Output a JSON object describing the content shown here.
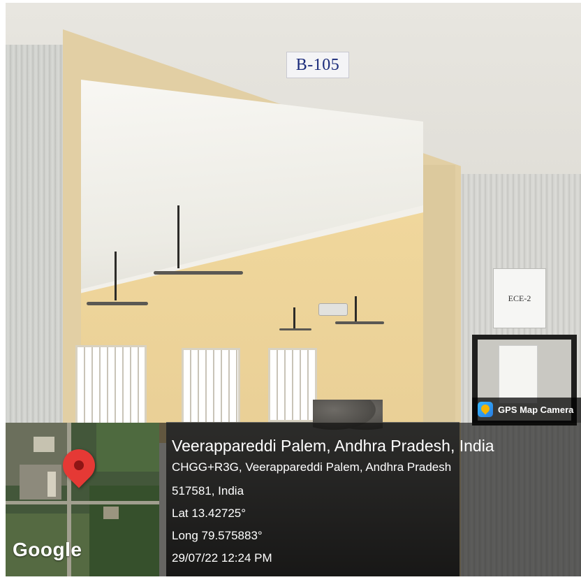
{
  "scene": {
    "room_sign": "B-105",
    "door_sign": "ECE-2"
  },
  "overlay": {
    "badge_label": "GPS Map Camera",
    "badge_icon": "gps-map-camera-icon",
    "map_watermark": "Google",
    "title": "Veerappareddi Palem, Andhra Pradesh, India",
    "address_line1": "CHGG+R3G, Veerappareddi Palem, Andhra Pradesh",
    "address_line2": "517581, India",
    "latitude": "Lat 13.42725°",
    "longitude": "Long 79.575883°",
    "datetime": "29/07/22 12:24 PM",
    "pin_icon": "location-pin-icon"
  },
  "colors": {
    "pin": "#e53935",
    "overlay_bg": "rgba(0,0,0,0.58)",
    "room_sign_text": "#1a2a7a"
  }
}
